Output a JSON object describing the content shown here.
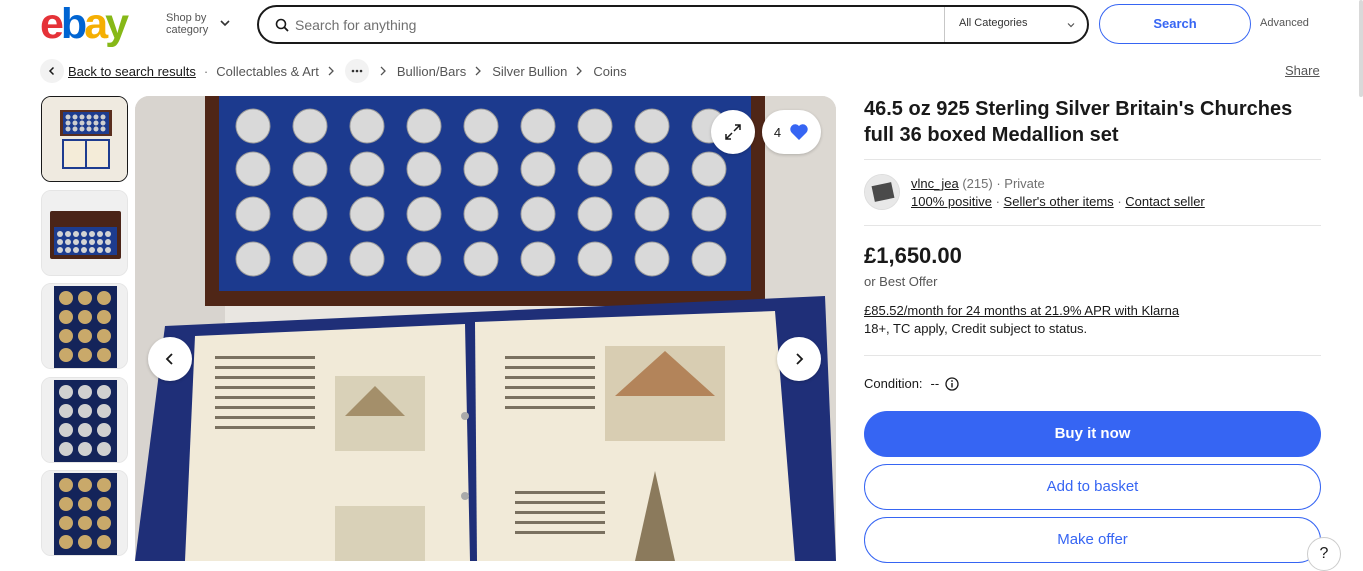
{
  "header": {
    "shop_by_line1": "Shop by",
    "shop_by_line2": "category",
    "search_placeholder": "Search for anything",
    "category_select": "All Categories",
    "search_button": "Search",
    "advanced_link": "Advanced"
  },
  "breadcrumb": {
    "back": "Back to search results",
    "items": [
      "Collectables & Art",
      "Bullion/Bars",
      "Silver Bullion",
      "Coins"
    ],
    "share": "Share"
  },
  "gallery": {
    "watch_count": "4",
    "thumbnail_count": 5
  },
  "listing": {
    "title": "46.5 oz 925 Sterling Silver Britain's Churches full 36 boxed Medallion set",
    "seller": {
      "name": "vlnc_jea",
      "feedback_count": "(215)",
      "type": "Private",
      "positive": "100% positive",
      "other_items": "Seller's other items",
      "contact": "Contact seller"
    },
    "price": "£1,650.00",
    "best_offer": "or Best Offer",
    "klarna": "£85.52/month for 24 months at 21.9% APR with Klarna",
    "klarna_note": "18+, TC apply, Credit subject to status.",
    "condition_label": "Condition:",
    "condition_value": "--",
    "buy_now": "Buy it now",
    "add_to_basket": "Add to basket",
    "make_offer": "Make offer"
  },
  "colors": {
    "accent": "#3665f3",
    "ebay_red": "#e53238",
    "ebay_blue": "#0064d2",
    "ebay_yellow": "#f5af02",
    "ebay_green": "#86b817"
  },
  "help": "?"
}
